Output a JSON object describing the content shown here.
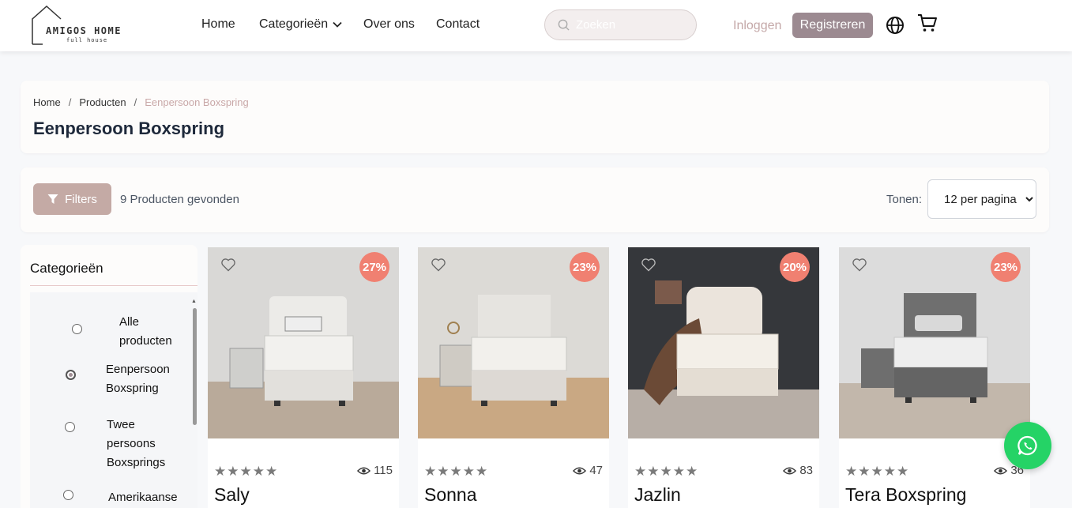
{
  "brand": {
    "name": "AMIGOS HOME",
    "tagline": "full house"
  },
  "nav": {
    "home": "Home",
    "categories": "Categorieën",
    "about": "Over ons",
    "contact": "Contact"
  },
  "search": {
    "placeholder": "Zoeken"
  },
  "auth": {
    "login": "Inloggen",
    "register": "Registreren"
  },
  "breadcrumb": {
    "items": [
      "Home",
      "Producten",
      "Eenpersoon Boxspring"
    ],
    "separator": "/"
  },
  "page": {
    "title": "Eenpersoon Boxspring"
  },
  "toolbar": {
    "filter_label": "Filters",
    "found_text": "9 Producten gevonden",
    "show_label": "Tonen:",
    "per_page_options": [
      "12 per pagina"
    ],
    "per_page_selected": "12 per pagina"
  },
  "sidebar": {
    "title": "Categorieën",
    "categories": [
      {
        "label": "Alle producten",
        "checked": false
      },
      {
        "label": "Eenpersoon Boxspring",
        "checked": true
      },
      {
        "label": "Twee persoons Boxsprings",
        "checked": false
      },
      {
        "label": "Amerikaanse",
        "checked": false
      }
    ]
  },
  "products": [
    {
      "name": "Saly",
      "discount": "27%",
      "views": "115",
      "rating": 0,
      "image": "bed-light-wall"
    },
    {
      "name": "Sonna",
      "discount": "23%",
      "views": "47",
      "rating": 0,
      "image": "bed-light-wood"
    },
    {
      "name": "Jazlin",
      "discount": "20%",
      "views": "83",
      "rating": 0,
      "image": "bed-dark-wall"
    },
    {
      "name": "Tera Boxspring",
      "discount": "23%",
      "views": "36",
      "rating": 0,
      "image": "bed-grey"
    }
  ],
  "colors": {
    "accent": "#9c8a91",
    "filter_button": "#c4aaa5",
    "discount_badge": "#f08071",
    "whatsapp": "#25d366",
    "breadcrumb_active": "#c9a8a8"
  }
}
